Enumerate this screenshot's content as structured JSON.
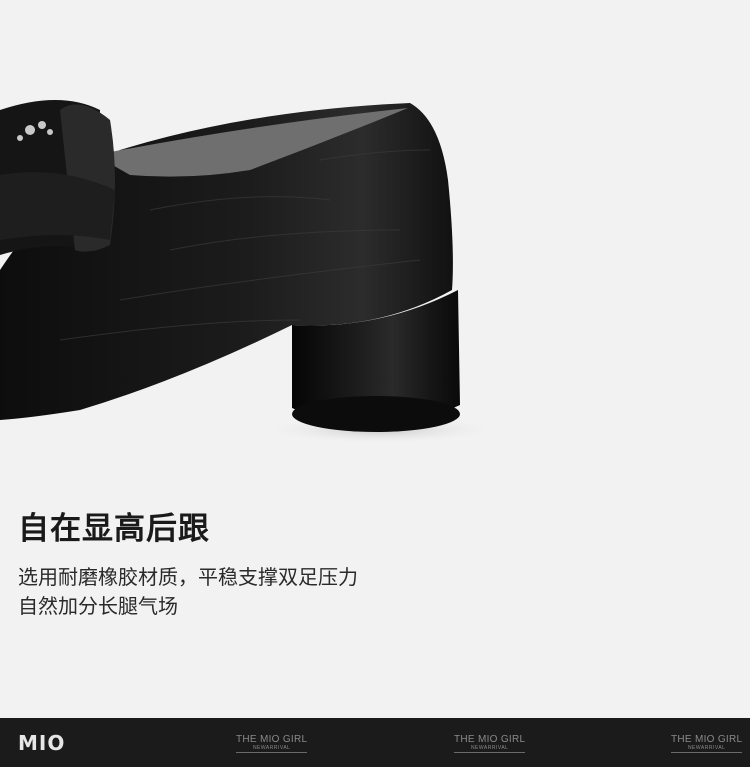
{
  "feature": {
    "headline": "自在显高后跟",
    "description_lines": [
      "选用耐磨橡胶材质，平稳支撑双足压力",
      "自然加分长腿气场"
    ]
  },
  "footer": {
    "brand": "MIO",
    "watermarks": [
      {
        "title": "THE MIO GIRL",
        "subtitle": "NEWARRIVAL"
      },
      {
        "title": "THE MIO GIRL",
        "subtitle": "NEWARRIVAL"
      },
      {
        "title": "THE MIO GIRL",
        "subtitle": "NEWARRIVAL"
      }
    ]
  },
  "colors": {
    "background": "#f2f2f2",
    "footer": "#1b1b1b",
    "text": "#1a1a1a"
  }
}
